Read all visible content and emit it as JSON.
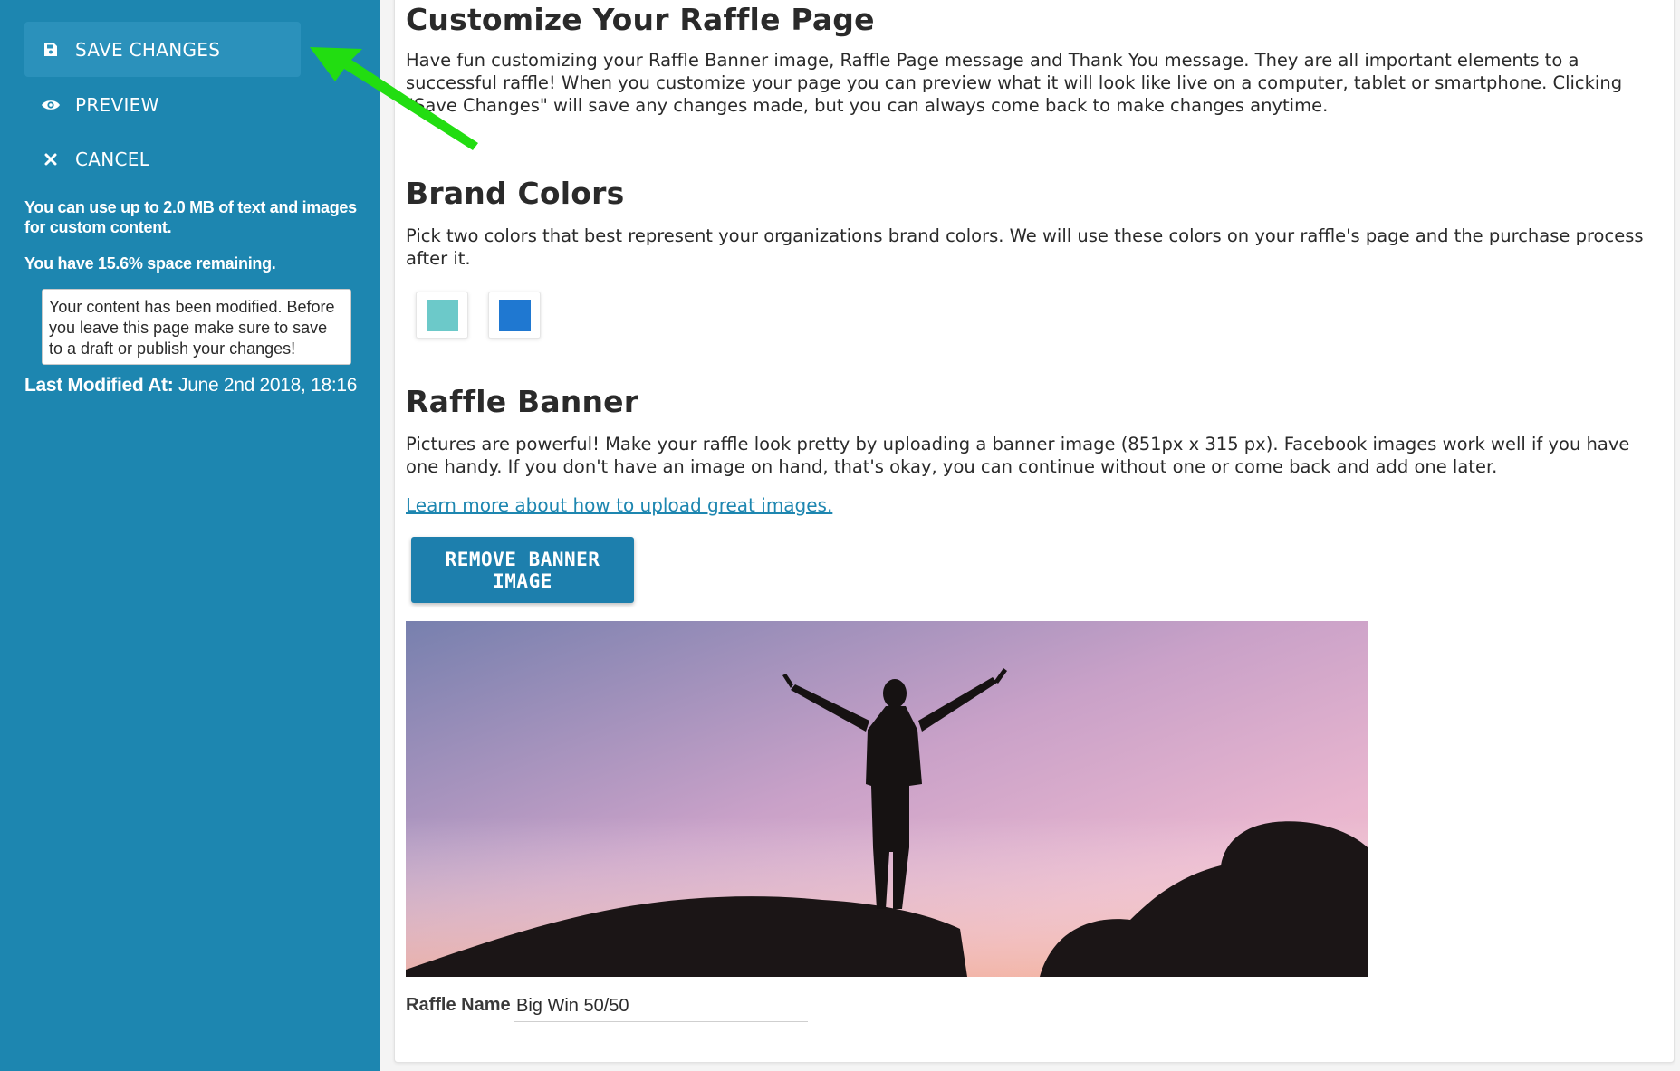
{
  "sidebar": {
    "save_label": "SAVE CHANGES",
    "preview_label": "PREVIEW",
    "cancel_label": "CANCEL",
    "quota_text": "You can use up to 2.0 MB of text and images for custom content.",
    "remaining_text": "You have 15.6% space remaining.",
    "notice_text": "Your content has been modified. Before you leave this page make sure to save to a draft or publish your changes!",
    "last_modified_label": "Last Modified At:",
    "last_modified_value": "June 2nd 2018, 18:16"
  },
  "customize": {
    "title": "Customize Your Raffle Page",
    "description": "Have fun customizing your Raffle Banner image, Raffle Page message and Thank You message. They are all important elements to a successful raffle! When you customize your page you can preview what it will look like live on a computer, tablet or smartphone. Clicking \"Save Changes\" will save any changes made, but you can always come back to make changes anytime."
  },
  "brand_colors": {
    "title": "Brand Colors",
    "description": "Pick two colors that best represent your organizations brand colors. We will use these colors on your raffle's page and the purchase process after it.",
    "primary": "#6cc9c9",
    "secondary": "#1f78d1"
  },
  "banner": {
    "title": "Raffle Banner",
    "description": "Pictures are powerful! Make your raffle look pretty by uploading a banner image (851px x 315 px). Facebook images work well if you have one handy. If you don't have an image on hand, that's okay, you can continue without one or come back and add one later.",
    "learn_link": "Learn more about how to upload great images.",
    "remove_label": "Remove Banner Image"
  },
  "raffle_name": {
    "label": "Raffle Name",
    "value": "Big Win 50/50"
  },
  "colors": {
    "sidebar_bg": "#1d86b0",
    "accent": "#1d7fad",
    "arrow": "#22dd11"
  }
}
